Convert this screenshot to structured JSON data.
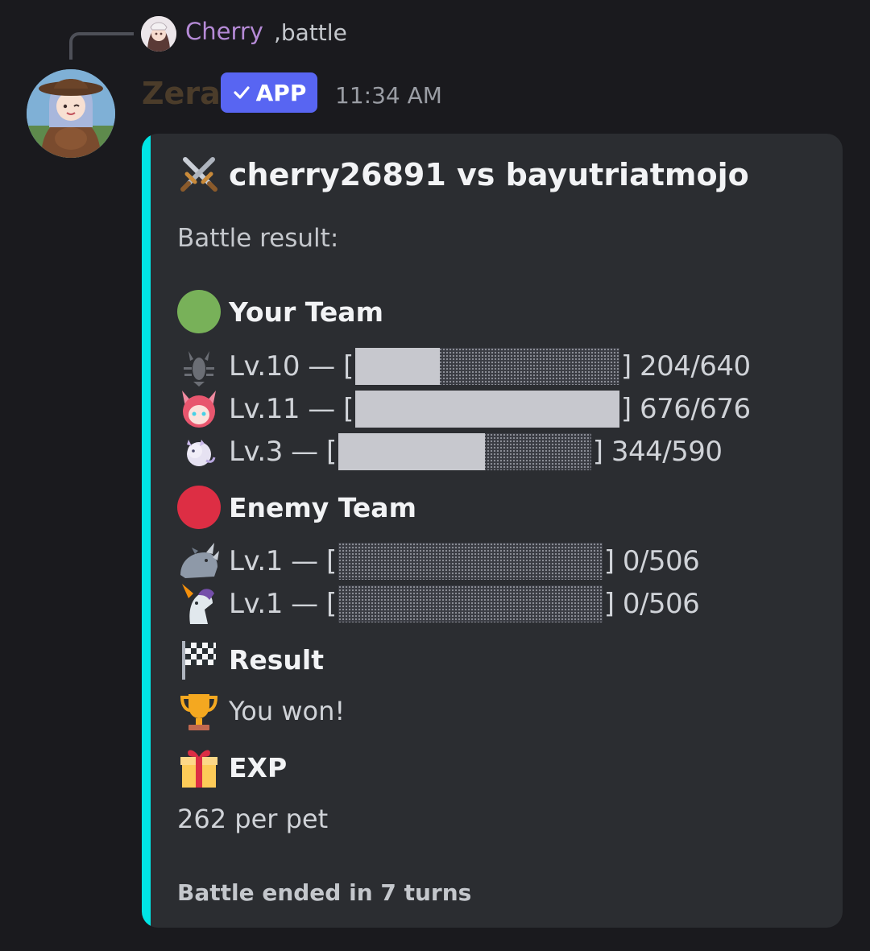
{
  "reply": {
    "author": "Cherry",
    "text": ",battle",
    "avatar_icon": "reply-avatar"
  },
  "message": {
    "author": "Zera",
    "badge": "APP",
    "timestamp": "11:34 AM"
  },
  "embed": {
    "accent_color": "#00e5e5",
    "title": "cherry26891 vs bayutriatmojo",
    "description": "Battle result:",
    "your_team": {
      "title": "Your Team",
      "pets": [
        {
          "icon": "lobster-icon",
          "prefix": "Lv.10 — [",
          "hp": "] 204/640",
          "fill": 0.32
        },
        {
          "icon": "fox-girl-icon",
          "prefix": "Lv.11 — [",
          "hp": "] 676/676",
          "fill": 1.0
        },
        {
          "icon": "dragon-icon",
          "prefix": "Lv.3 — [",
          "hp": "] 344/590",
          "fill": 0.58
        }
      ]
    },
    "enemy_team": {
      "title": "Enemy Team",
      "pets": [
        {
          "icon": "rhino-icon",
          "prefix": "Lv.1 — [",
          "hp": "] 0/506",
          "fill": 0.0
        },
        {
          "icon": "unicorn-icon",
          "prefix": "Lv.1 — [",
          "hp": "] 0/506",
          "fill": 0.0
        }
      ]
    },
    "result": {
      "title": "Result",
      "text": "You won!"
    },
    "exp": {
      "title": "EXP",
      "text": "262 per pet"
    },
    "footer": "Battle ended in 7 turns"
  }
}
